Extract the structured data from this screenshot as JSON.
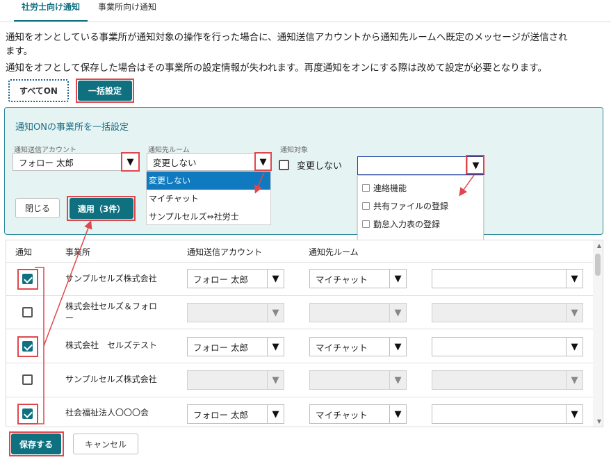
{
  "tabs": [
    {
      "label": "社労士向け通知",
      "active": true
    },
    {
      "label": "事業所向け通知",
      "active": false
    }
  ],
  "description": {
    "line1": "通知をオンとしている事業所が通知対象の操作を行った場合に、通知送信アカウントから通知先ルームへ既定のメッセージが送信され",
    "line1b": "ます。",
    "line2": "通知をオフとして保存した場合はその事業所の設定情報が失われます。再度通知をオンにする際は改めて設定が必要となります。"
  },
  "buttons": {
    "all_on": "すべてON",
    "bulk_set": "一括設定",
    "close": "閉じる",
    "apply": "適用（3件）",
    "save": "保存する",
    "cancel": "キャンセル"
  },
  "bulk_panel": {
    "title": "通知ONの事業所を一括設定",
    "account_label": "通知送信アカウント",
    "account_value": "フォロー 太郎",
    "room_label": "通知先ルーム",
    "room_value": "変更しない",
    "room_options": [
      "変更しない",
      "マイチャット",
      "サンプルセルズ⇔社労士"
    ],
    "target_label": "通知対象",
    "target_nochange": "変更しない",
    "target_value": "",
    "target_options": [
      "連絡機能",
      "共有ファイルの登録",
      "勤怠入力表の登録"
    ]
  },
  "table": {
    "headers": {
      "notify": "通知",
      "office": "事業所",
      "account": "通知送信アカウント",
      "room": "通知先ルーム"
    },
    "rows": [
      {
        "on": true,
        "office": "サンプルセルズ株式会社",
        "office2": "",
        "account": "フォロー 太郎",
        "room": "マイチャット",
        "target": ""
      },
      {
        "on": false,
        "office": "株式会社セルズ＆フォロ",
        "office2": "ー",
        "account": "",
        "room": "",
        "target": ""
      },
      {
        "on": true,
        "office": "株式会社　セルズテスト",
        "office2": "",
        "account": "フォロー 太郎",
        "room": "マイチャット",
        "target": ""
      },
      {
        "on": false,
        "office": "サンプルセルズ株式会社",
        "office2": "",
        "account": "",
        "room": "",
        "target": ""
      },
      {
        "on": true,
        "office": "社会福祉法人〇〇〇会",
        "office2": "",
        "account": "フォロー 太郎",
        "room": "マイチャット",
        "target": ""
      }
    ]
  },
  "icons": {
    "dropdown_arrow": "▼",
    "scroll_up": "▲",
    "scroll_down": "▼"
  },
  "colors": {
    "primary": "#0f7080",
    "highlight": "#e0474d",
    "panel_bg": "#e6f3f3",
    "selected_option": "#0f7ac0"
  }
}
